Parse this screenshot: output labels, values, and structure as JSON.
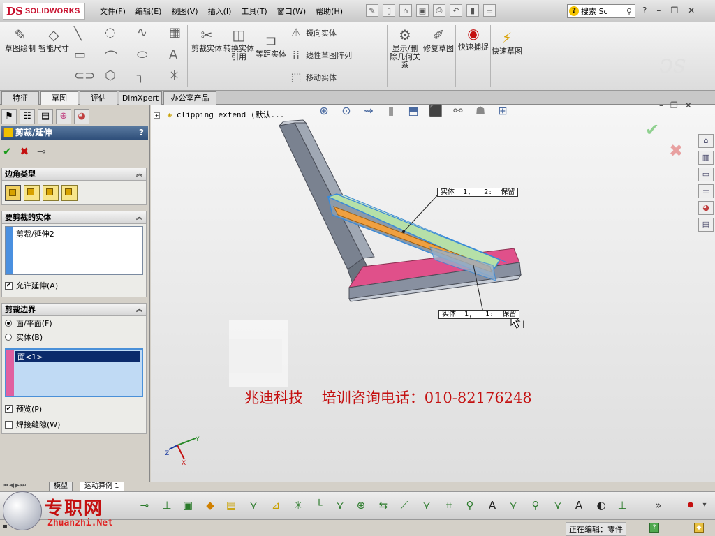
{
  "app": {
    "brand": "SOLIDWORKS",
    "brand_mark": "DS"
  },
  "menu": [
    "文件(F)",
    "编辑(E)",
    "视图(V)",
    "插入(I)",
    "工具(T)",
    "窗口(W)",
    "帮助(H)"
  ],
  "search": {
    "placeholder": "搜索 Sc"
  },
  "ribbon": {
    "sketch": "草图绘制",
    "smart_dim": "智能尺寸",
    "trim": "剪裁实体",
    "convert": "转换实体引用",
    "offset": "等距实体",
    "mirror": "镜向实体",
    "linear_pattern": "线性草图阵列",
    "move": "移动实体",
    "show_delete": "显示/删除几何关系",
    "repair": "修复草图",
    "quick_snap": "快速捕捉",
    "rapid_sketch": "快速草图"
  },
  "tabs": [
    "特征",
    "草图",
    "评估",
    "DimXpert",
    "办公室产品"
  ],
  "property_manager": {
    "title": "剪裁/延伸",
    "help": "?",
    "corner_group": "边角类型",
    "bodies_group": "要剪裁的实体",
    "bodies_list": [
      "剪裁/延伸2"
    ],
    "allow_extend": "允许延伸(A)",
    "boundary_group": "剪裁边界",
    "opt_face": "面/平面(F)",
    "opt_body": "实体(B)",
    "boundary_list": [
      "面<1>"
    ],
    "preview": "预览(P)",
    "weld_gap": "焊接缝隙(W)"
  },
  "viewport": {
    "tree_item": "clipping_extend  (默认...",
    "callout_top": "实体  1,   2:  保留",
    "callout_bottom": "实体  1,   1:  保留",
    "watermark": "兆迪科技    培训咨询电话：010-82176248"
  },
  "bottom_tabs": [
    "模型",
    "运动算例 1"
  ],
  "status": {
    "editing": "正在编辑：零件"
  },
  "site": {
    "cn": "专职网",
    "en": "Zhuanzhi.Net"
  },
  "colors": {
    "accent_red": "#c41010",
    "selection_blue": "#0b2a6b",
    "frame_gray": "#808890",
    "highlight_pink": "#e0508a"
  }
}
